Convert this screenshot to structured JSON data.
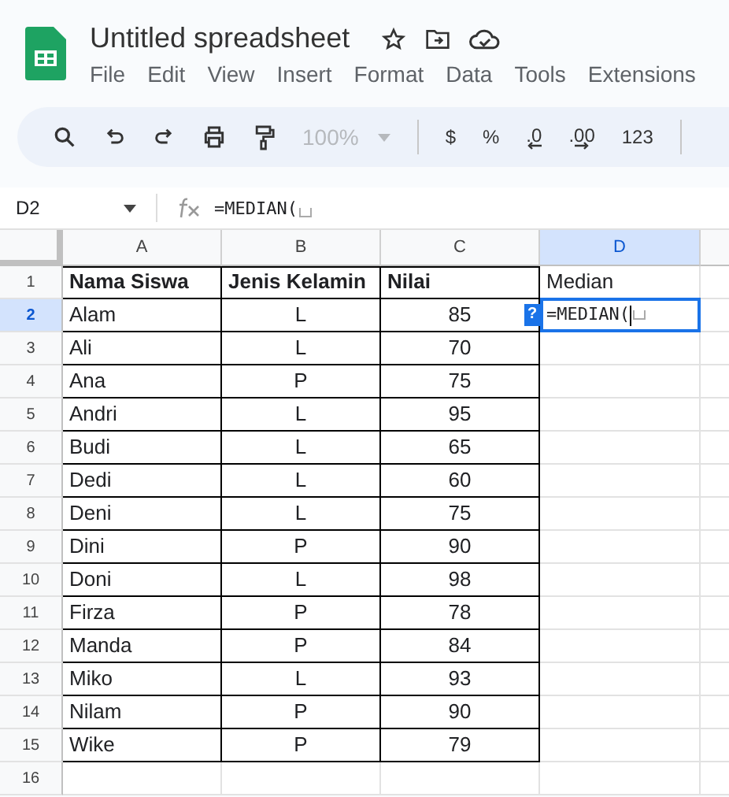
{
  "title": "Untitled spreadsheet",
  "menu": [
    "File",
    "Edit",
    "View",
    "Insert",
    "Format",
    "Data",
    "Tools",
    "Extensions"
  ],
  "toolbar": {
    "zoom": {
      "label": "100%",
      "disabled": true
    },
    "format_buttons": [
      "$",
      "%",
      ".0",
      ".00",
      "123"
    ]
  },
  "formula_bar": {
    "name_box": "D2",
    "formula": "=MEDIAN("
  },
  "columns": [
    {
      "label": "A",
      "selected": false
    },
    {
      "label": "B",
      "selected": false
    },
    {
      "label": "C",
      "selected": false
    },
    {
      "label": "D",
      "selected": true
    }
  ],
  "header_row": {
    "number": "1",
    "selected": false,
    "cells": [
      {
        "text": "Nama Siswa",
        "bold": true
      },
      {
        "text": "Jenis Kelamin",
        "bold": true
      },
      {
        "text": "Nilai",
        "bold": true
      },
      {
        "text": "Median",
        "bold": false
      }
    ]
  },
  "rows": [
    {
      "number": "2",
      "selected": true,
      "cells": [
        "Alam",
        "L",
        "85"
      ]
    },
    {
      "number": "3",
      "selected": false,
      "cells": [
        "Ali",
        "L",
        "70"
      ]
    },
    {
      "number": "4",
      "selected": false,
      "cells": [
        "Ana",
        "P",
        "75"
      ]
    },
    {
      "number": "5",
      "selected": false,
      "cells": [
        "Andri",
        "L",
        "95"
      ]
    },
    {
      "number": "6",
      "selected": false,
      "cells": [
        "Budi",
        "L",
        "65"
      ]
    },
    {
      "number": "7",
      "selected": false,
      "cells": [
        "Dedi",
        "L",
        "60"
      ]
    },
    {
      "number": "8",
      "selected": false,
      "cells": [
        "Deni",
        "L",
        "75"
      ]
    },
    {
      "number": "9",
      "selected": false,
      "cells": [
        "Dini",
        "P",
        "90"
      ]
    },
    {
      "number": "10",
      "selected": false,
      "cells": [
        "Doni",
        "L",
        "98"
      ]
    },
    {
      "number": "11",
      "selected": false,
      "cells": [
        "Firza",
        "P",
        "78"
      ]
    },
    {
      "number": "12",
      "selected": false,
      "cells": [
        "Manda",
        "P",
        "84"
      ]
    },
    {
      "number": "13",
      "selected": false,
      "cells": [
        "Miko",
        "L",
        "93"
      ]
    },
    {
      "number": "14",
      "selected": false,
      "cells": [
        "Nilam",
        "P",
        "90"
      ]
    },
    {
      "number": "15",
      "selected": false,
      "cells": [
        "Wike",
        "P",
        "79"
      ]
    },
    {
      "number": "16",
      "selected": false
    }
  ],
  "cell_editor": {
    "hint": "?",
    "value": "=MEDIAN("
  }
}
